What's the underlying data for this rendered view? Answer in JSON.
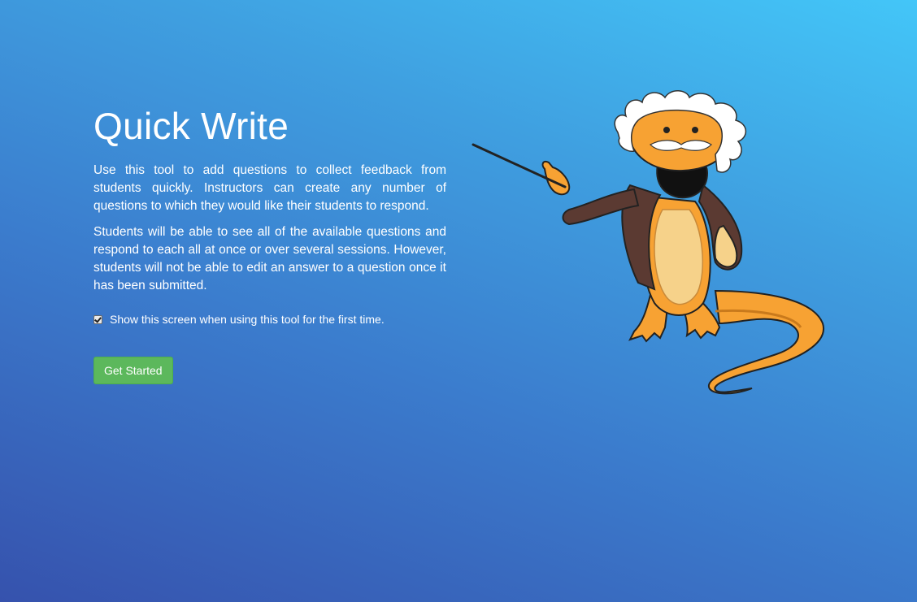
{
  "intro": {
    "title": "Quick Write",
    "paragraphs": [
      "Use this tool to add questions to collect feedback from students quickly. Instructors can create any number of questions to which they would like their students to respond.",
      "Students will be able to see all of the available questions and respond to each all at once or over several sessions. However, students will not be able to edit an answer to a question once it has been submitted."
    ],
    "show_screen_label": "Show this screen when using this tool for the first time.",
    "show_screen_checked": true,
    "get_started_label": "Get Started"
  },
  "colors": {
    "background_top": "#43c6f8",
    "background_bottom": "#3652ad",
    "button": "#5cb85c",
    "mascot_body": "#f7a233",
    "mascot_jacket": "#5b3a32"
  },
  "icons": {
    "mascot": "professor-lizard-mascot"
  }
}
